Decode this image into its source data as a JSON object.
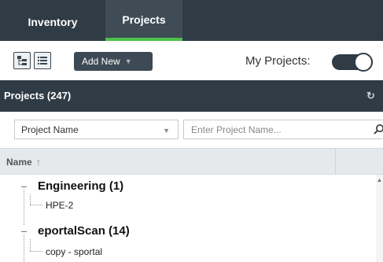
{
  "nav": {
    "tabs": [
      {
        "label": "Inventory",
        "active": false
      },
      {
        "label": "Projects",
        "active": true
      }
    ]
  },
  "toolbar": {
    "tree_view_icon": "tree-view-icon",
    "list_view_icon": "list-view-icon",
    "add_new_label": "Add New",
    "my_projects_label": "My Projects:",
    "my_projects_on": true
  },
  "panel": {
    "title": "Projects (247)",
    "refresh_icon": "refresh-icon"
  },
  "filter": {
    "field_selected": "Project Name",
    "search_placeholder": "Enter Project Name...",
    "search_icon": "search-icon"
  },
  "table": {
    "column_name": "Name",
    "sort_indicator": "↑"
  },
  "tree": [
    {
      "label": "Engineering (1)",
      "children": [
        "HPE-2"
      ]
    },
    {
      "label": "eportalScan (14)",
      "children": [
        "copy - sportal"
      ]
    }
  ],
  "colors": {
    "nav_bg": "#2f3b45",
    "active_tab_bg": "#3f4b55",
    "accent_green": "#4cc24a",
    "header_gray": "#e6e9eb"
  }
}
